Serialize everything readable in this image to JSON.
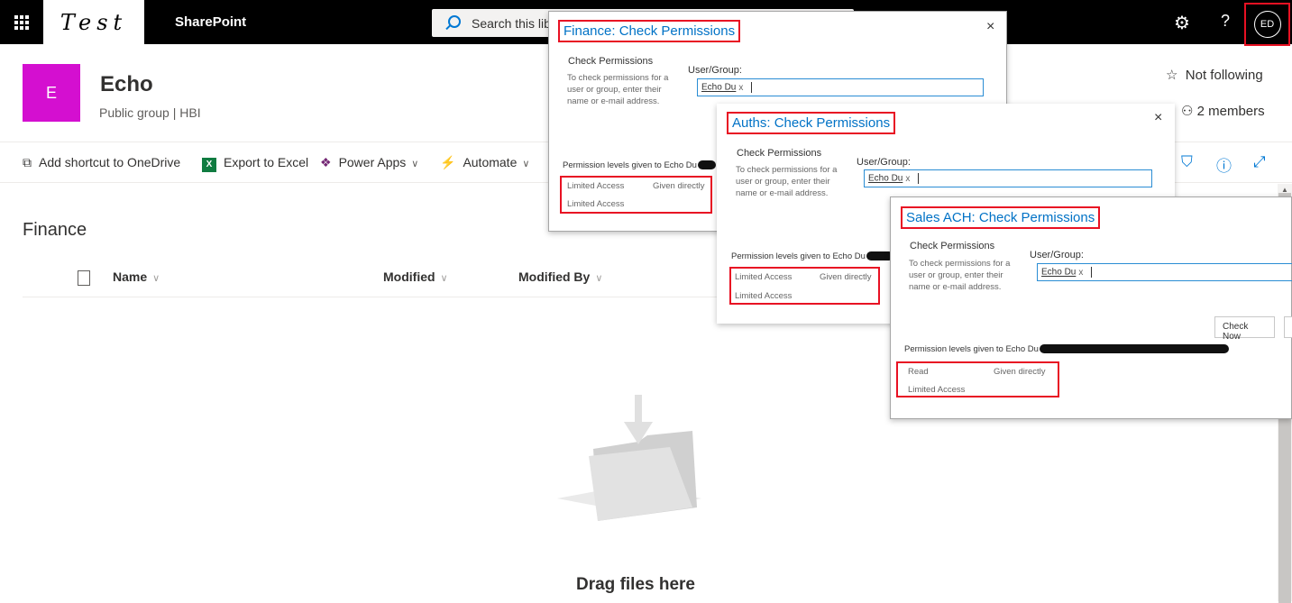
{
  "topbar": {
    "logo_text": "Test",
    "app_name": "SharePoint",
    "search_placeholder": "Search this lib",
    "avatar_initials": "ED"
  },
  "site": {
    "tile_letter": "E",
    "title": "Echo",
    "subtitle": "Public group | HBI",
    "follow_label": "Not following",
    "members_label": "2 members"
  },
  "commands": {
    "shortcut": "Add shortcut to OneDrive",
    "excel": "Export to Excel",
    "powerapps": "Power Apps",
    "automate": "Automate"
  },
  "library": {
    "title": "Finance",
    "columns": [
      "Name",
      "Modified",
      "Modified By"
    ],
    "empty_text": "Drag files here"
  },
  "dialogs": [
    {
      "title": "Finance: Check Permissions",
      "section": "Check Permissions",
      "description": "To check permissions for a user or group, enter their name or e-mail address.",
      "ug_label": "User/Group:",
      "user_token": "Echo Du",
      "perm_given": "Permission levels given to Echo Du",
      "perms": [
        {
          "level": "Limited Access",
          "how": "Given directly"
        },
        {
          "level": "Limited Access",
          "how": ""
        }
      ]
    },
    {
      "title": "Auths: Check Permissions",
      "section": "Check Permissions",
      "description": "To check permissions for a user or group, enter their name or e-mail address.",
      "ug_label": "User/Group:",
      "user_token": "Echo Du",
      "perm_given": "Permission levels given to Echo Du",
      "perms": [
        {
          "level": "Limited Access",
          "how": "Given directly"
        },
        {
          "level": "Limited Access",
          "how": ""
        }
      ]
    },
    {
      "title": "Sales ACH: Check Permissions",
      "section": "Check Permissions",
      "description": "To check permissions for a user or group, enter their name or e-mail address.",
      "ug_label": "User/Group:",
      "user_token": "Echo Du",
      "check_now": "Check Now",
      "perm_given": "Permission levels given to Echo Du",
      "perms": [
        {
          "level": "Read",
          "how": "Given directly"
        },
        {
          "level": "Limited Access",
          "how": ""
        }
      ]
    }
  ],
  "colors": {
    "tile": "#d40fd0",
    "highlight": "#e81123",
    "link": "#0072c6"
  }
}
